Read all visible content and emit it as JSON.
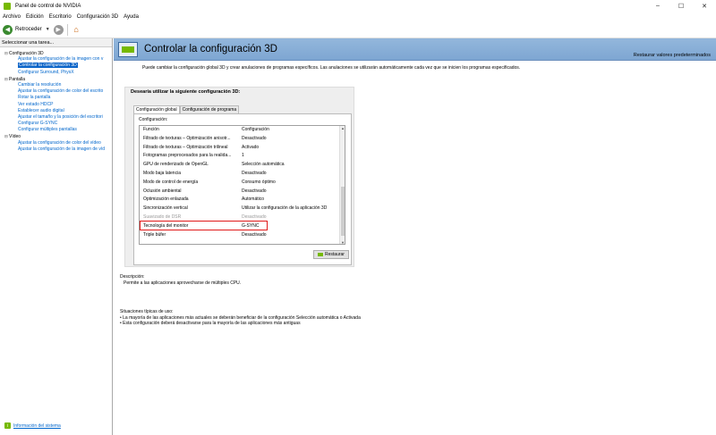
{
  "window": {
    "title": "Panel de control de NVIDIA",
    "controls": [
      "–",
      "☐",
      "✕"
    ]
  },
  "menu": [
    "Archivo",
    "Edición",
    "Escritorio",
    "Configuración 3D",
    "Ayuda"
  ],
  "toolbar": {
    "back_label": "Retroceder"
  },
  "sidebar": {
    "header": "Seleccionar una tarea...",
    "tree": [
      {
        "label": "Configuración 3D",
        "type": "cat"
      },
      {
        "label": "Ajustar la configuración de la imagen con v",
        "type": "child"
      },
      {
        "label": "Controlar la configuración 3D",
        "type": "child",
        "selected": true
      },
      {
        "label": "Configurar Surround, PhysX",
        "type": "child"
      },
      {
        "label": "Pantalla",
        "type": "cat"
      },
      {
        "label": "Cambiar la resolución",
        "type": "child"
      },
      {
        "label": "Ajustar la configuración de color del escrito",
        "type": "child"
      },
      {
        "label": "Rotar la pantalla",
        "type": "child"
      },
      {
        "label": "Ver estado HDCP",
        "type": "child"
      },
      {
        "label": "Establecer audio digital",
        "type": "child"
      },
      {
        "label": "Ajustar el tamaño y la posición del escritori",
        "type": "child"
      },
      {
        "label": "Configurar G-SYNC",
        "type": "child"
      },
      {
        "label": "Configurar múltiples pantallas",
        "type": "child"
      },
      {
        "label": "Vídeo",
        "type": "cat"
      },
      {
        "label": "Ajustar la configuración de color del vídeo",
        "type": "child"
      },
      {
        "label": "Ajustar la configuración de la imagen de víd",
        "type": "child"
      }
    ],
    "footer_link": "Información del sistema"
  },
  "banner": {
    "title": "Controlar la configuración 3D",
    "restore_defaults": "Restaurar valores predeterminados"
  },
  "intro": "Puede cambiar la configuración global 3D y crear anulaciones de programas específicos. Las anulaciones se utilizarán automáticamente cada vez que se inicien los programas especificados.",
  "config": {
    "heading": "Desearía utilizar la siguiente configuración 3D:",
    "tabs": [
      "Configuración global",
      "Configuración de programa"
    ],
    "settings_label": "Configuración:",
    "columns": [
      "Función",
      "Configuración"
    ],
    "rows": [
      {
        "feature": "Filtrado de texturas – Optimización anisotr...",
        "value": "Desactivado"
      },
      {
        "feature": "Filtrado de texturas – Optimización trilineal",
        "value": "Activado"
      },
      {
        "feature": "Fotogramas preprocesados para la realida...",
        "value": "1"
      },
      {
        "feature": "GPU de renderizado de OpenGL",
        "value": "Selección automática"
      },
      {
        "feature": "Modo baja latencia",
        "value": "Desactivado"
      },
      {
        "feature": "Modo de control de energía",
        "value": "Consumo óptimo"
      },
      {
        "feature": "Oclusión ambiental",
        "value": "Desactivado"
      },
      {
        "feature": "Optimización enlazada",
        "value": "Automático"
      },
      {
        "feature": "Sincronización vertical",
        "value": "Utilizar la configuración de la aplicación 3D"
      },
      {
        "feature": "Suavizado de DSR",
        "value": "Desactivado",
        "disabled": true
      },
      {
        "feature": "Tecnología del monitor",
        "value": "G-SYNC"
      },
      {
        "feature": "Triple búfer",
        "value": "Desactivado"
      }
    ],
    "restore_button": "Restaurar"
  },
  "description": {
    "label": "Descripción:",
    "text": "Permite a las aplicaciones aprovecharse de múltiples CPU."
  },
  "usage": {
    "label": "Situaciones típicas de uso:",
    "items": [
      "• La mayoría de las aplicaciones más actuales se deberán beneficiar de la configuración Selección automática o Activada",
      "• Esta configuración deberá desactivarse para la mayoría de las aplicaciones más antiguas"
    ]
  }
}
